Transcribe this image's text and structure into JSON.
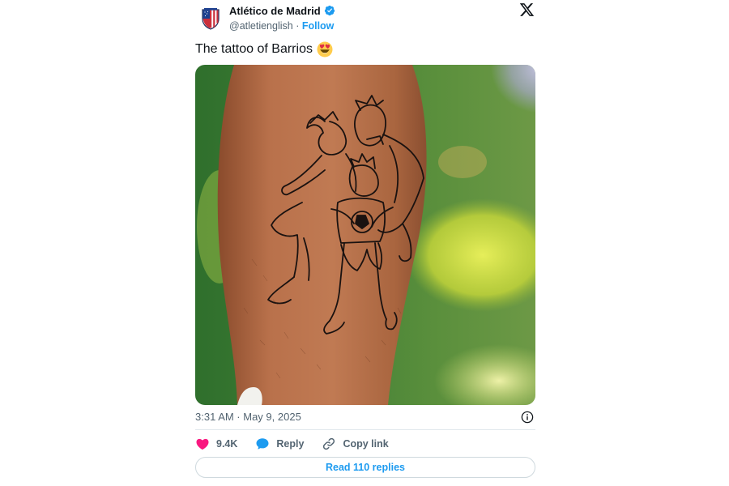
{
  "tweet": {
    "author": {
      "display_name": "Atlético de Madrid",
      "handle": "@atletienglish",
      "separator": " · ",
      "follow_label": "Follow",
      "verified": true,
      "avatar_icon": "atletico-crest-icon"
    },
    "text": "The tattoo of Barrios",
    "emoji": "heart-eyes-emoji",
    "media": {
      "description_icon": "tattoo-photo"
    },
    "timestamp": "3:31 AM · May 9, 2025",
    "actions": {
      "like_count": "9.4K",
      "reply_label": "Reply",
      "copy_link_label": "Copy link"
    },
    "read_replies_label": "Read 110 replies"
  },
  "colors": {
    "accent": "#1d9bf0",
    "like": "#f91880",
    "text_primary": "#0f1419",
    "text_secondary": "#536471"
  }
}
